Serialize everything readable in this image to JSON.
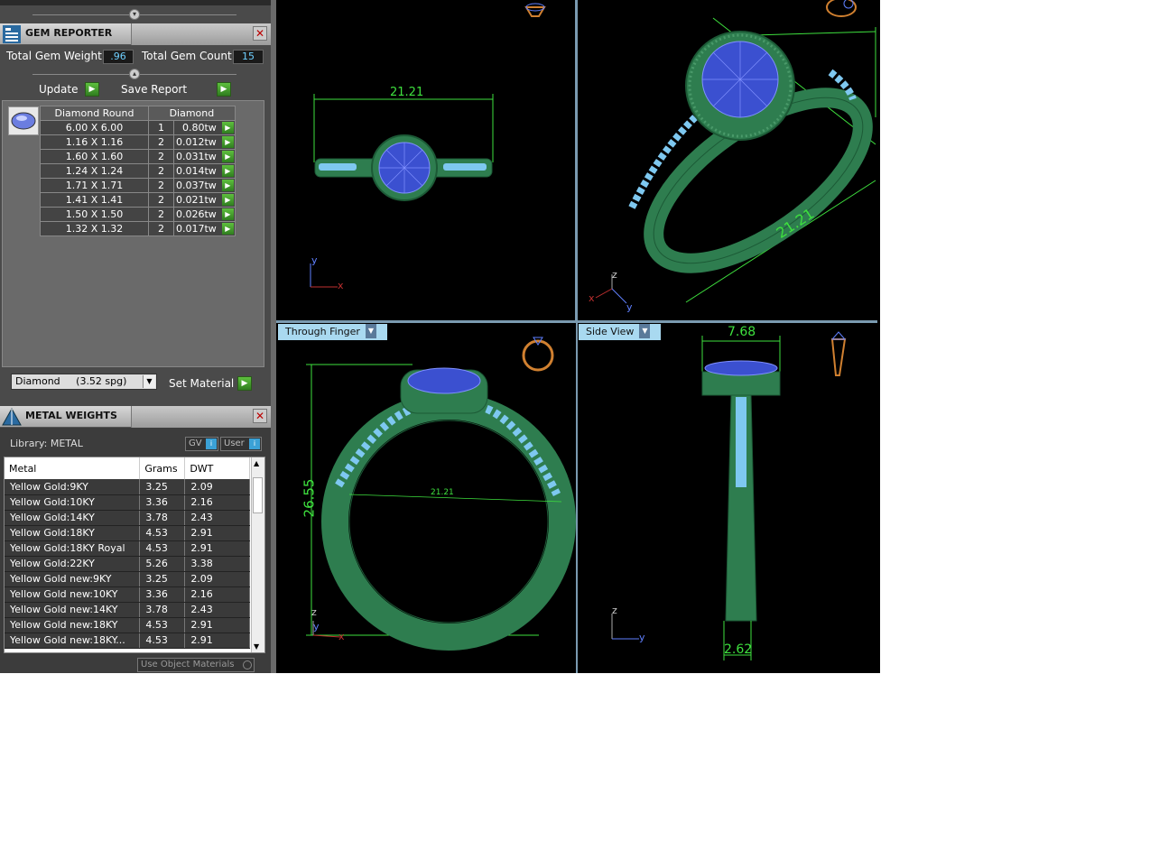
{
  "gem_reporter": {
    "title": "GEM REPORTER",
    "total_weight_label": "Total Gem Weight",
    "total_weight_value": ".96",
    "total_count_label": "Total Gem Count",
    "total_count_value": "15",
    "update_label": "Update",
    "save_report_label": "Save Report",
    "table_header": [
      "Diamond Round",
      "Diamond"
    ],
    "rows": [
      {
        "size": "6.00 X 6.00",
        "count": "1",
        "weight": "0.80tw"
      },
      {
        "size": "1.16 X 1.16",
        "count": "2",
        "weight": "0.012tw"
      },
      {
        "size": "1.60 X 1.60",
        "count": "2",
        "weight": "0.031tw"
      },
      {
        "size": "1.24 X 1.24",
        "count": "2",
        "weight": "0.014tw"
      },
      {
        "size": "1.71 X 1.71",
        "count": "2",
        "weight": "0.037tw"
      },
      {
        "size": "1.41 X 1.41",
        "count": "2",
        "weight": "0.021tw"
      },
      {
        "size": "1.50 X 1.50",
        "count": "2",
        "weight": "0.026tw"
      },
      {
        "size": "1.32 X 1.32",
        "count": "2",
        "weight": "0.017tw"
      }
    ],
    "material_select": "Diamond     (3.52 spg)",
    "set_material_label": "Set Material"
  },
  "metal_weights": {
    "title": "METAL WEIGHTS",
    "library_label": "Library: METAL",
    "gv_label": "GV",
    "user_label": "User",
    "columns": [
      "Metal",
      "Grams",
      "DWT"
    ],
    "rows": [
      {
        "metal": "Yellow Gold:9KY",
        "grams": "3.25",
        "dwt": "2.09"
      },
      {
        "metal": "Yellow Gold:10KY",
        "grams": "3.36",
        "dwt": "2.16"
      },
      {
        "metal": "Yellow Gold:14KY",
        "grams": "3.78",
        "dwt": "2.43"
      },
      {
        "metal": "Yellow Gold:18KY",
        "grams": "4.53",
        "dwt": "2.91"
      },
      {
        "metal": "Yellow Gold:18KY Royal",
        "grams": "4.53",
        "dwt": "2.91"
      },
      {
        "metal": "Yellow Gold:22KY",
        "grams": "5.26",
        "dwt": "3.38"
      },
      {
        "metal": "Yellow Gold new:9KY",
        "grams": "3.25",
        "dwt": "2.09"
      },
      {
        "metal": "Yellow Gold new:10KY",
        "grams": "3.36",
        "dwt": "2.16"
      },
      {
        "metal": "Yellow Gold new:14KY",
        "grams": "3.78",
        "dwt": "2.43"
      },
      {
        "metal": "Yellow Gold new:18KY",
        "grams": "4.53",
        "dwt": "2.91"
      },
      {
        "metal": "Yellow Gold new:18KY...",
        "grams": "4.53",
        "dwt": "2.91"
      }
    ],
    "use_object_label": "Use Object Materials"
  },
  "viewports": {
    "top_left": {
      "dim": "21.21",
      "axis_y": "y",
      "axis_x": "x"
    },
    "top_right": {
      "dim": "21.21",
      "axis_z": "z",
      "axis_x": "x",
      "axis_y": "y"
    },
    "bottom_left": {
      "label": "Through Finger",
      "dim_h": "26.55",
      "dim_inner": "21.21",
      "axis_z": "z",
      "axis_y": "y",
      "axis_x": "x"
    },
    "bottom_right": {
      "label": "Side View",
      "dim_top": "7.68",
      "dim_bottom": "2.62",
      "axis_z": "z",
      "axis_y": "y"
    }
  },
  "colors": {
    "metal": "#2e7d4f",
    "gem": "#5a6fe0",
    "dim": "#3ee03e",
    "accent": "#a9d9f0"
  }
}
